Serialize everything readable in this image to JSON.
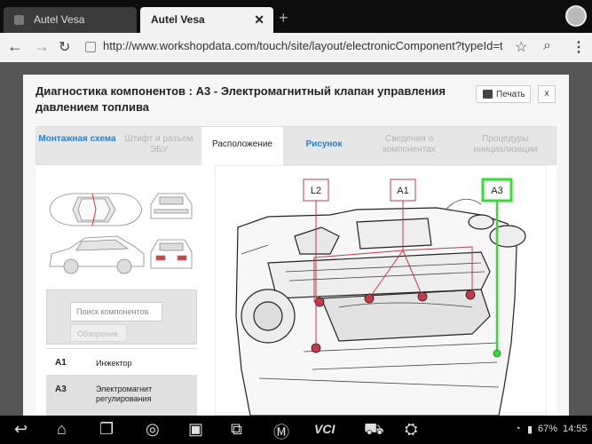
{
  "browser": {
    "tabs": [
      {
        "title": "Autel Vesa"
      },
      {
        "title": "Autel Vesa",
        "close": "✕"
      }
    ],
    "new_tab": "+",
    "url": "http://www.workshopdata.com/touch/site/layout/electronicComponent?typeId=t_"
  },
  "dialog": {
    "title": "Диагностика компонентов : A3 - Электромагнитный клапан управления давлением топлива",
    "print_label": "Печать",
    "close_label": "x",
    "tabs": [
      {
        "label": "Монтажная схема",
        "state": "blue"
      },
      {
        "label": "Штифт и разъем ЭБУ",
        "state": "grey"
      },
      {
        "label": "Расположение",
        "state": "active"
      },
      {
        "label": "Рисунок",
        "state": "blue"
      },
      {
        "label": "Сведения о компонентах",
        "state": "grey"
      },
      {
        "label": "Процедуры инициализации",
        "state": "grey"
      }
    ],
    "search_placeholder": "Поиск компонентов",
    "search_button": "Обзорение",
    "components": [
      {
        "code": "A1",
        "name": "Инжектор"
      },
      {
        "code": "A3",
        "name": "Электромагнит регулирования"
      }
    ],
    "labels": [
      "L2",
      "A1",
      "A3"
    ]
  },
  "status": {
    "battery": "67%",
    "time": "14:55",
    "vci": "VCI"
  },
  "colors": {
    "accent": "#2b7fc4",
    "callout_red": "#c33a4a",
    "highlight_green": "#33dd33"
  }
}
